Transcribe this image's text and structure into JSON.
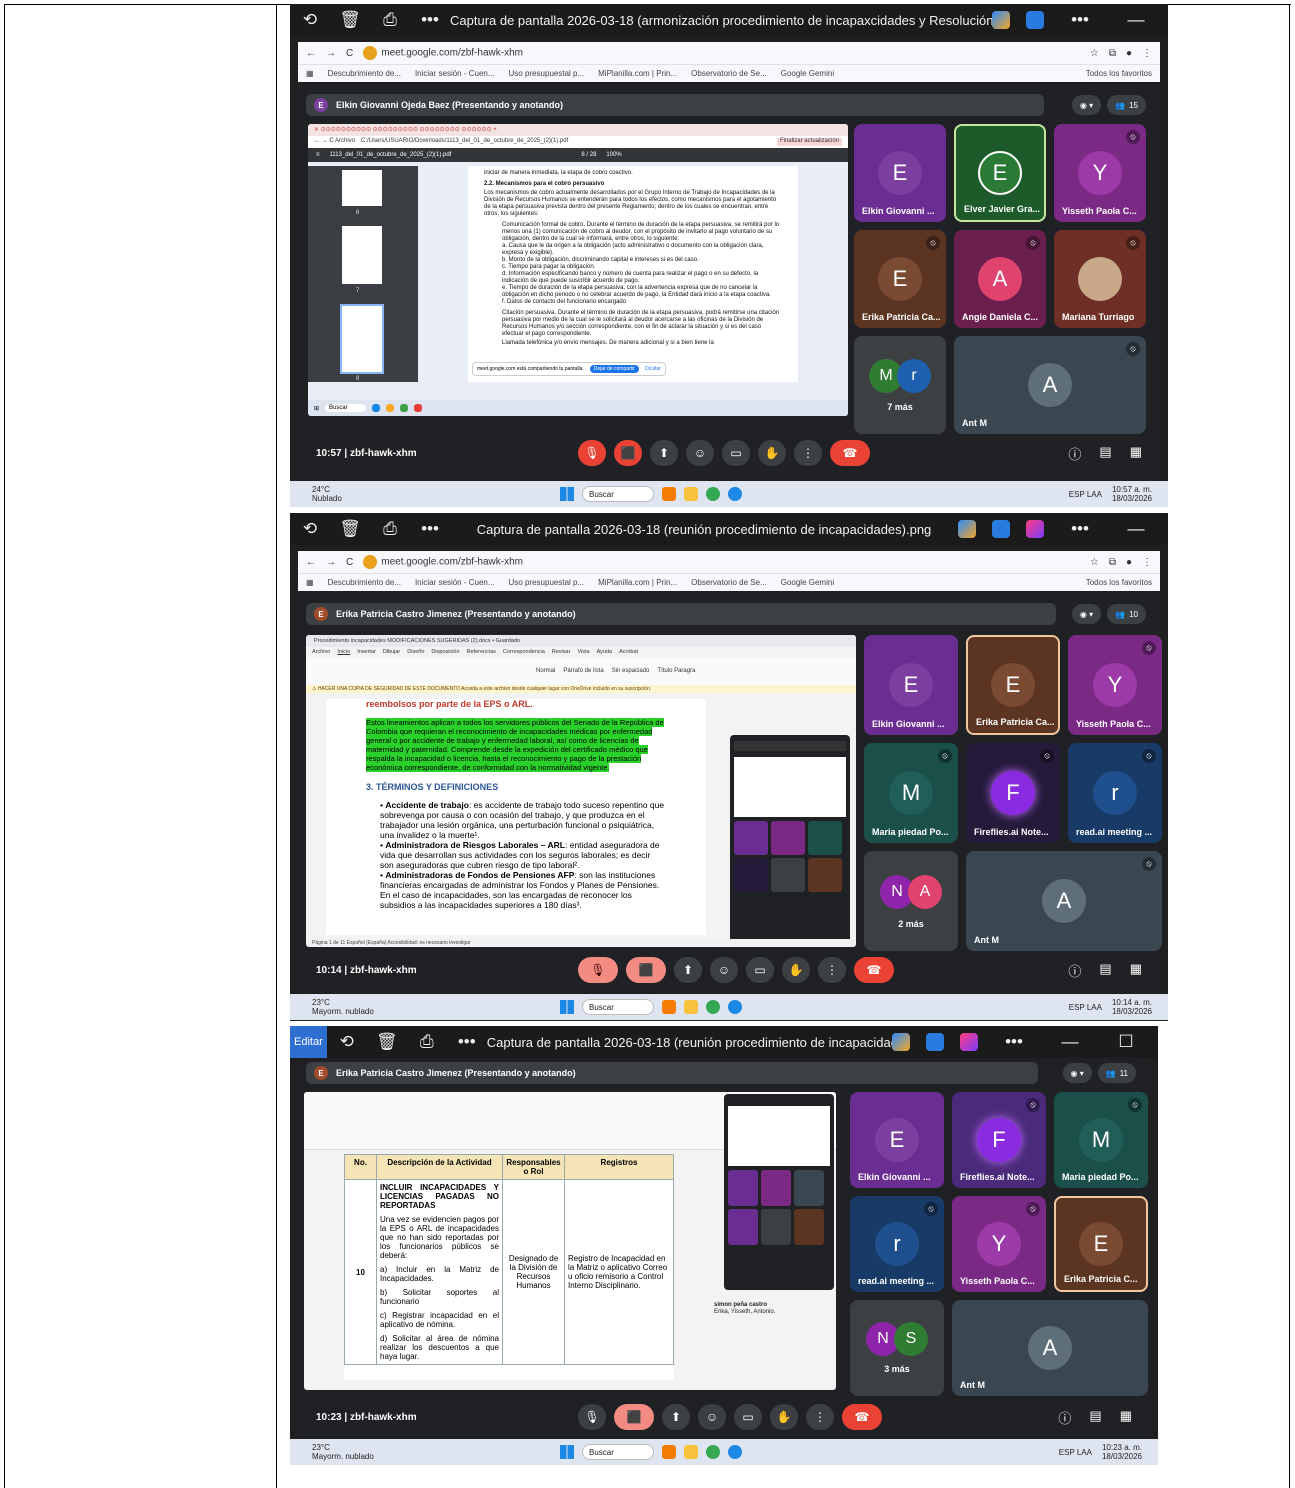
{
  "shots": [
    {
      "viewer_title": "Captura de pantalla 2026-03-18 (armonización procedimiento de incapaxcidades y Resolución).png",
      "url": "meet.google.com/zbf-hawk-xhm",
      "bookmarks": [
        "Descubrimiento de...",
        "Iniciar sesión - Cuen...",
        "Uso presupuestal p...",
        "MiPlanilla.com | Prin...",
        "Observatorio de Se...",
        "Google Gemini"
      ],
      "bookmarks_right": "Todos los favoritos",
      "presenter": "Elkin Giovanni Ojeda Baez (Presentando y anotando)",
      "participants_count": "15",
      "meeting_time": "10:57",
      "meeting_code": "zbf-hawk-xhm",
      "weather_temp": "24°C",
      "weather_desc": "Nublado",
      "taskbar_search": "Buscar",
      "lang": "ESP LAA",
      "clock_time": "10:57 a. m.",
      "clock_date": "18/03/2026",
      "pdf": {
        "path": "C:/Users/USUARIO/Downloads/1113_del_01_de_octubre_de_2025_(2)(1).pdf",
        "filename": "1113_del_01_de_octubre_de_2025_(2)(1).pdf",
        "page": "8 / 28",
        "zoom": "100%",
        "update_btn": "Finalizar actualización",
        "thumb_pages": [
          "6",
          "7",
          "8"
        ],
        "intro": "iniciar de manera inmediata, la etapa de cobro coactivo.",
        "section": "2.2.    Mecanismos para el cobro persuasivo",
        "para1": "Los mecanismos de cobro actualmente desarrollados por el Grupo Interno de Trabajo de Incapacidades de la División de Recursos Humanos se entenderán para todos los efectos, como mecanismos para el agotamiento de la etapa persuasiva prevista dentro del presente Reglamento; dentro de los cuales se encuentran, entre otros, los siguientes:",
        "para2": "Comunicación formal de cobro. Durante el término de duración de la etapa persuasiva, se remitirá por lo menos una (1) comunicación de cobro al deudor, con el propósito de invitarlo al pago voluntario de su obligación, dentro de la cual se informará, entre otros, lo siguiente:",
        "items": [
          "a.  Causa que le da origen a la obligación (acto administrativo o documento con la obligación clara, expresa y exigible).",
          "b.  Monto de la obligación, discriminando capital e intereses si es del caso.",
          "c.  Tiempo para pagar la obligación.",
          "d.  Información especificando banco y número de cuenta para realizar el pago o en su defecto, la indicación de que puede suscribir acuerdo de pago.",
          "e.  Tiempo de duración de la etapa persuasiva, con la advertencia expresa que de no cancelar la obligación en dicho periodo o no celebrar acuerdo de pago, la Entidad dará inicio a la etapa coactiva.",
          "f.   Datos de contacto del funcionario encargado"
        ],
        "para3": "Citación persuasiva. Durante el término de duración de la etapa persuasiva, podrá remitirse una citación persuasiva por medio de la cual se le solicitará al deudor acercarse a las oficinas de la División de Recursos Humanos y/o sección correspondiente, con el fin de aclarar la situación y si es del caso efectuar el pago correspondiente.",
        "para4": "Llamada telefónica y/o envío mensajes. De manera adicional y si a bien tiene la",
        "share_msg": "meet.google.com está compartiendo tu pantalla.",
        "share_btn": "Dejar de compartir",
        "share_hide": "Ocultar",
        "inner_search": "Buscar"
      },
      "tiles": [
        {
          "name": "Elkin Giovanni ...",
          "initial": "E",
          "bg": "#6a2d91",
          "av": "#7b3fa0"
        },
        {
          "name": "Elver Javier Gra...",
          "initial": "E",
          "bg": "#1e5b2a",
          "av": "#2a7a35"
        },
        {
          "name": "Yisseth Paola C...",
          "initial": "Y",
          "bg": "#7a2a85",
          "av": "#9c3aa8"
        },
        {
          "name": "Erika Patricia Ca...",
          "initial": "E",
          "bg": "#5b3422",
          "av": "#7a4a33"
        },
        {
          "name": "Angie Daniela C...",
          "initial": "A",
          "bg": "#6b1f4f",
          "av": "#e0436e"
        },
        {
          "name": "Mariana Turriago",
          "initial": "M",
          "bg": "#6e2f26",
          "av": "#c9a88a"
        },
        {
          "name": "",
          "initial": "M",
          "bg": "#3c4043",
          "av": "#2f7d32",
          "more": "7 más"
        },
        {
          "name": "Ant M",
          "initial": "A",
          "bg": "#3a4650",
          "av": "#5f6f7a"
        }
      ]
    },
    {
      "viewer_title": "Captura de pantalla 2026-03-18 (reunión procedimiento de incapacidades).png",
      "url": "meet.google.com/zbf-hawk-xhm",
      "bookmarks": [
        "Descubrimiento de...",
        "Iniciar sesión - Cuen...",
        "Uso presupuestal p...",
        "MiPlanilla.com | Prin...",
        "Observatorio de Se...",
        "Google Gemini"
      ],
      "bookmarks_right": "Todos los favoritos",
      "presenter": "Erika Patricia Castro Jimenez (Presentando y anotando)",
      "participants_count": "10",
      "meeting_time": "10:14",
      "meeting_code": "zbf-hawk-xhm",
      "weather_temp": "23°C",
      "weather_desc": "Mayorm. nublado",
      "taskbar_search": "Buscar",
      "lang": "ESP LAA",
      "clock_time": "10:14 a. m.",
      "clock_date": "18/03/2026",
      "word": {
        "title": "Procedimiento incapacidades MODIFICACIONES SUGERIDAS (2).docx • Guardado",
        "tabs": [
          "Archivo",
          "Inicio",
          "Insertar",
          "Dibujar",
          "Diseño",
          "Disposición",
          "Referencias",
          "Correspondencia",
          "Revisar",
          "Vista",
          "Ayuda",
          "Acrobat"
        ],
        "styles": [
          "Normal",
          "Párrafo de lista",
          "Sin espaciado",
          "Título Paragra"
        ],
        "warning": "HACER UNA COPIA DE SEGURIDAD DE ESTE DOCUMENTO  Acceda a este archivo desde cualquier lugar con OneDrive incluido en su suscripción.",
        "top_text": "reembolsos por parte de la EPS o ARL.",
        "highlight": "Estos lineamientos aplican a todos los servidores públicos del Senado de la República de Colombia que requieran el reconocimiento de incapacidades médicas por enfermedad general o por accidente de trabajo y enfermedad laboral, así como de licencias de maternidad y paternidad. Comprende desde la expedición del certificado médico que respalda la incapacidad o licencia, hasta el reconocimiento y pago de la prestación económica correspondiente, de conformidad con la normatividad vigente.",
        "section": "3. TÉRMINOS Y DEFINICIONES",
        "bullets": [
          {
            "term": "Accidente de trabajo",
            "text": ": es accidente de trabajo todo suceso repentino que sobrevenga por causa o con ocasión del trabajo, y que produzca en el trabajador una lesión orgánica, una perturbación funcional o psiquiátrica, una invalidez o la muerte¹."
          },
          {
            "term": "Administradora de Riesgos Laborales – ARL",
            "text": ": entidad aseguradora de vida que desarrollan sus actividades con los seguros laborales; es decir son aseguradoras que cubren riesgo de tipo laboral²."
          },
          {
            "term": "Administradoras de Fondos de Pensiones AFP",
            "text": ": son las instituciones financieras encargadas de administrar los Fondos y Planes de Pensiones. En el caso de incapacidades, son las encargadas de reconocer los subsidios a las incapacidades superiores a 180 días³."
          }
        ],
        "status": "Página 1 de 11   Español (España)   Accesibilidad: es necesario investigar"
      },
      "tiles": [
        {
          "name": "Elkin Giovanni ...",
          "initial": "E",
          "bg": "#6a2d91",
          "av": "#7b3fa0"
        },
        {
          "name": "Erika Patricia Ca...",
          "initial": "E",
          "bg": "#5b3422",
          "av": "#7a4a33"
        },
        {
          "name": "Yisseth Paola C...",
          "initial": "Y",
          "bg": "#7a2a85",
          "av": "#9c3aa8"
        },
        {
          "name": "Maria piedad Po...",
          "initial": "M",
          "bg": "#1b4f4a",
          "av": "#215e57"
        },
        {
          "name": "Fireflies.ai Note...",
          "initial": "F",
          "bg": "#241a3a",
          "av": "#8a2be2"
        },
        {
          "name": "read.ai meeting ...",
          "initial": "r",
          "bg": "#173a66",
          "av": "#1f4f8c"
        },
        {
          "name": "",
          "initial": "N",
          "bg": "#3c4043",
          "av": "#8e24aa",
          "more": "2 más"
        },
        {
          "name": "Ant M",
          "initial": "A",
          "bg": "#3a4650",
          "av": "#5f6f7a"
        }
      ]
    },
    {
      "viewer_title": "Captura de pantalla 2026-03-18 (reunión procedimiento de incapacidades-2).png",
      "edit_label": "Editar",
      "presenter": "Erika Patricia Castro Jimenez (Presentando y anotando)",
      "participants_count": "11",
      "meeting_time": "10:23",
      "meeting_code": "zbf-hawk-xhm",
      "weather_temp": "23°C",
      "weather_desc": "Mayorm. nublado",
      "taskbar_search": "Buscar",
      "lang": "ESP LAA",
      "clock_time": "10:23 a. m.",
      "clock_date": "18/03/2026",
      "table": {
        "headers": [
          "No.",
          "Descripción de la Actividad",
          "Responsables o Rol",
          "Registros"
        ],
        "row_no": "10",
        "title": "INCLUIR INCAPACIDADES Y LICENCIAS PAGADAS NO REPORTADAS",
        "desc": "Una vez se evidencien pagos por la EPS o ARL de incapacidades que no han sido reportadas por los funcionarios públicos se deberá:",
        "steps": [
          "a)  Incluir en la Matriz de Incapacidades.",
          "b) Solicitar soportes al funcionario",
          "c)  Registrar incapacidad en el aplicativo de nómina.",
          "d) Solicitar al área de nómina realizar los descuentos a que haya lugar."
        ],
        "resp": "Designado de la División de Recursos Humanos",
        "registro": "Registro de Incapacidad en la Matriz o aplicativo Correo u oficio remisorio a Control Interno Disciplinario."
      },
      "comment": {
        "author": "simon peña castro",
        "text": "Erika, Yisseth, Antonio."
      },
      "tiles": [
        {
          "name": "Elkin Giovanni ...",
          "initial": "E",
          "bg": "#6a2d91",
          "av": "#7b3fa0"
        },
        {
          "name": "Fireflies.ai Note...",
          "initial": "F",
          "bg": "#4a2a7a",
          "av": "#8a2be2"
        },
        {
          "name": "Maria piedad Po...",
          "initial": "M",
          "bg": "#1b4f4a",
          "av": "#215e57"
        },
        {
          "name": "read.ai meeting ...",
          "initial": "r",
          "bg": "#173a66",
          "av": "#1f4f8c"
        },
        {
          "name": "Yisseth Paola C...",
          "initial": "Y",
          "bg": "#7a2a85",
          "av": "#9c3aa8"
        },
        {
          "name": "Erika Patricia C...",
          "initial": "E",
          "bg": "#5b3422",
          "av": "#7a4a33"
        },
        {
          "name": "",
          "initial": "N",
          "bg": "#3c4043",
          "av": "#8e24aa",
          "more": "3 más"
        },
        {
          "name": "Ant M",
          "initial": "A",
          "bg": "#3a4650",
          "av": "#5f6f7a"
        }
      ]
    }
  ]
}
